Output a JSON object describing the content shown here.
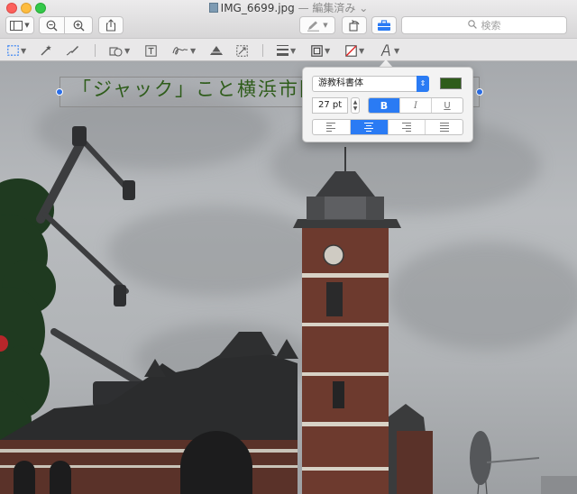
{
  "window": {
    "filename": "IMG_6699.jpg",
    "edited_label": "— 編集済み",
    "chevron": "⌄"
  },
  "toolbar": {
    "search_placeholder": "検索",
    "icons": [
      "sidebar-view-icon",
      "zoom-out-icon",
      "zoom-in-icon",
      "share-icon",
      "markup-pen-icon",
      "rotate-icon",
      "toolbox-icon",
      "search-icon"
    ]
  },
  "markup": {
    "tools": [
      "rectangular-selection-icon",
      "instant-alpha-icon",
      "sketch-icon",
      "shapes-icon",
      "text-tool-icon",
      "signature-icon",
      "adjust-color-icon",
      "adjust-size-icon",
      "shape-style-icon",
      "border-color-icon",
      "fill-color-icon",
      "text-style-icon"
    ]
  },
  "annotation": {
    "text": "「ジャック」こと横浜市開港",
    "color": "#2e5c1a"
  },
  "text_style": {
    "font": "游教科書体",
    "size": "27 pt",
    "bold": "B",
    "italic": "I",
    "underline": "U",
    "color": "#2e5c1a",
    "alignment_selected": "center"
  },
  "colors": {
    "accent": "#2a7bf4",
    "selection_handle": "#2a6ee8"
  }
}
